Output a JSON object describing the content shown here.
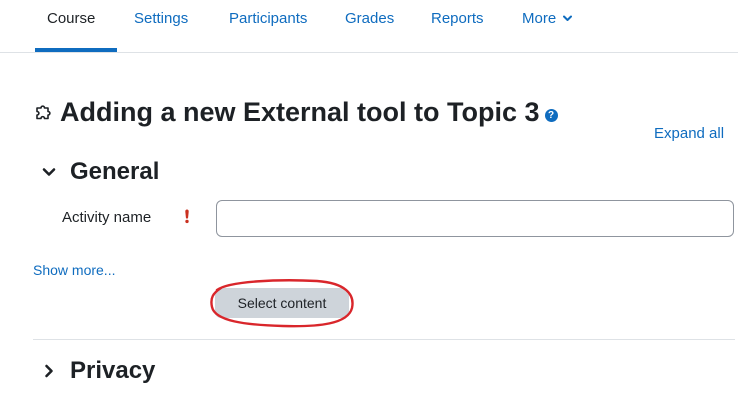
{
  "nav": {
    "items": [
      {
        "label": "Course",
        "active": true
      },
      {
        "label": "Settings",
        "active": false
      },
      {
        "label": "Participants",
        "active": false
      },
      {
        "label": "Grades",
        "active": false
      },
      {
        "label": "Reports",
        "active": false
      },
      {
        "label": "More",
        "active": false,
        "icon": "chevron-down-icon"
      }
    ]
  },
  "page": {
    "title": "Adding a new External tool to Topic 3",
    "title_icon": "puzzle-piece-icon",
    "help_icon": "question-circle-icon",
    "help_glyph": "?"
  },
  "form": {
    "expand_all": "Expand all",
    "sections": [
      {
        "title": "General",
        "expanded": true
      },
      {
        "title": "Privacy",
        "expanded": false
      }
    ],
    "activity_name": {
      "label": "Activity name",
      "value": "",
      "required": true,
      "required_icon": "exclamation-circle-icon"
    },
    "show_more": "Show more...",
    "select_content": "Select content"
  },
  "colors": {
    "link": "#0f6cbf",
    "text": "#1d2125",
    "required": "#ca3120",
    "annotation": "#d9262b",
    "button_bg": "#ced4da"
  }
}
